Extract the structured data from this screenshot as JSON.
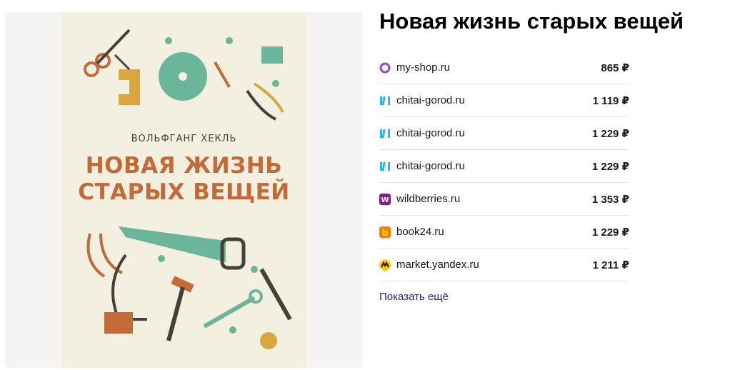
{
  "product": {
    "title": "Новая жизнь старых вещей",
    "cover": {
      "author": "ВОЛЬФГАНГ ХЕКЛЬ",
      "title_line1": "НОВАЯ ЖИЗНЬ",
      "title_line2": "СТАРЫХ ВЕЩЕЙ"
    }
  },
  "offers": [
    {
      "shop": "my-shop.ru",
      "price": "865 ₽",
      "icon": "my-shop-ring-icon",
      "icon_color": "#8a4fd1"
    },
    {
      "shop": "chitai-gorod.ru",
      "price": "1 119 ₽",
      "icon": "chitai-gorod-books-icon",
      "icon_color": "#2fb3e8"
    },
    {
      "shop": "chitai-gorod.ru",
      "price": "1 229 ₽",
      "icon": "chitai-gorod-books-icon",
      "icon_color": "#2fb3e8"
    },
    {
      "shop": "chitai-gorod.ru",
      "price": "1 229 ₽",
      "icon": "chitai-gorod-books-icon",
      "icon_color": "#2fb3e8"
    },
    {
      "shop": "wildberries.ru",
      "price": "1 353 ₽",
      "icon": "wildberries-w-icon",
      "icon_color": "#8b1a8c"
    },
    {
      "shop": "book24.ru",
      "price": "1 229 ₽",
      "icon": "book24-b-icon",
      "icon_color": "#ff7a00"
    },
    {
      "shop": "market.yandex.ru",
      "price": "1 211 ₽",
      "icon": "yandex-market-icon",
      "icon_color": "#ffcc00"
    }
  ],
  "show_more_label": "Показать ещё",
  "colors": {
    "accent_link": "#1f2a8c",
    "cover_title": "#c36a36",
    "cover_background": "#f3f0e1",
    "tool_green": "#6bb69a"
  }
}
